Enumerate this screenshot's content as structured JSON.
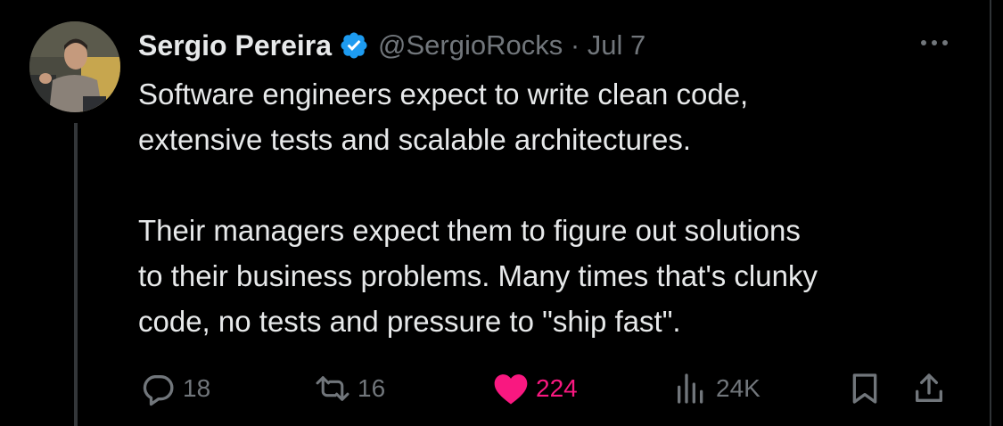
{
  "tweet": {
    "author_name": "Sergio Pereira",
    "handle_meta": "@SergioRocks · Jul 7",
    "text": "Software engineers expect to write clean code,\nextensive tests and scalable architectures.\n\nTheir managers expect them to figure out solutions\nto their business problems. Many times that's clunky\ncode, no tests and pressure to \"ship fast\".",
    "verified": true
  },
  "actions": {
    "replies": "18",
    "reposts": "16",
    "likes": "224",
    "views": "24K",
    "liked": true
  },
  "icons": {
    "reply": "speech-bubble-icon",
    "repost": "repost-arrows-icon",
    "like": "heart-icon",
    "views": "bar-chart-icon",
    "bookmark": "bookmark-icon",
    "share": "share-upload-icon",
    "more": "more-dots-icon",
    "verified": "verified-badge-icon"
  },
  "colors": {
    "background": "#000000",
    "text": "#e7e9ea",
    "muted": "#71767b",
    "like": "#f91880",
    "verified": "#1d9bf0",
    "thread_line": "#333639"
  }
}
